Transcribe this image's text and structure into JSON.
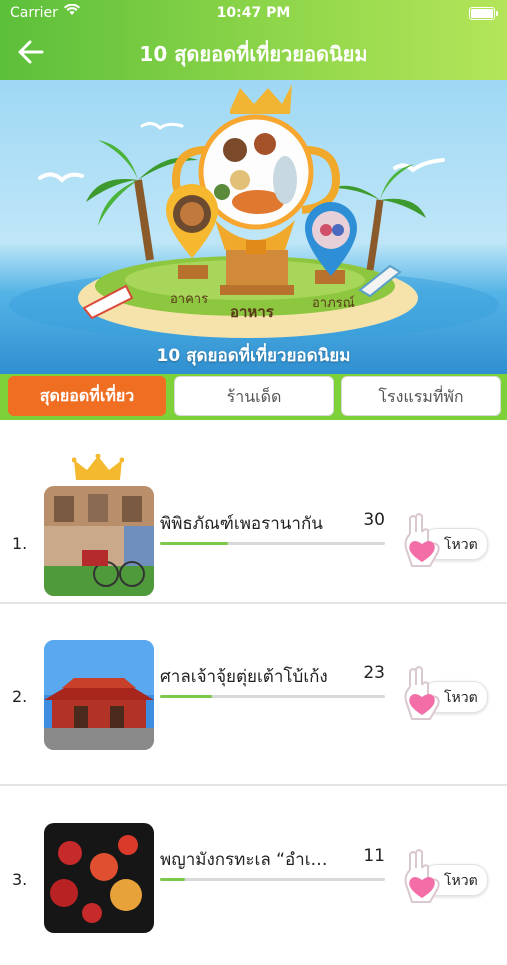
{
  "status_bar": {
    "carrier": "Carrier",
    "time": "10:47 PM"
  },
  "header": {
    "title": "10 สุดยอดที่เที่ยวยอดนิยม"
  },
  "banner": {
    "caption": "10 สุดยอดที่เที่ยวยอดนิยม",
    "labels": {
      "left": "อาคาร",
      "center": "อาหาร",
      "right": "อาภรณ์"
    }
  },
  "tabs": [
    {
      "label": "สุดยอดที่เที่ยว",
      "active": true
    },
    {
      "label": "ร้านเด็ด",
      "active": false
    },
    {
      "label": "โรงแรมที่พัก",
      "active": false
    }
  ],
  "ranking": {
    "vote_label": "โหวต",
    "max_votes": 30,
    "items": [
      {
        "rank": "1.",
        "name": "พิพิธภัณฑ์เพอรานากัน",
        "votes": "30"
      },
      {
        "rank": "2.",
        "name": "ศาลเจ้าจุ้ยตุ่ยเต้าโบ้เก้ง",
        "votes": "23"
      },
      {
        "rank": "3.",
        "name": "พญามังกรทะเล “อำเภอเมือง”",
        "votes": "11"
      }
    ]
  },
  "colors": {
    "accent_tab": "#f06e22",
    "header_green": "#5cbf3a",
    "vote_heart": "#f36ea6",
    "bar_fill": "#7cc84a"
  }
}
